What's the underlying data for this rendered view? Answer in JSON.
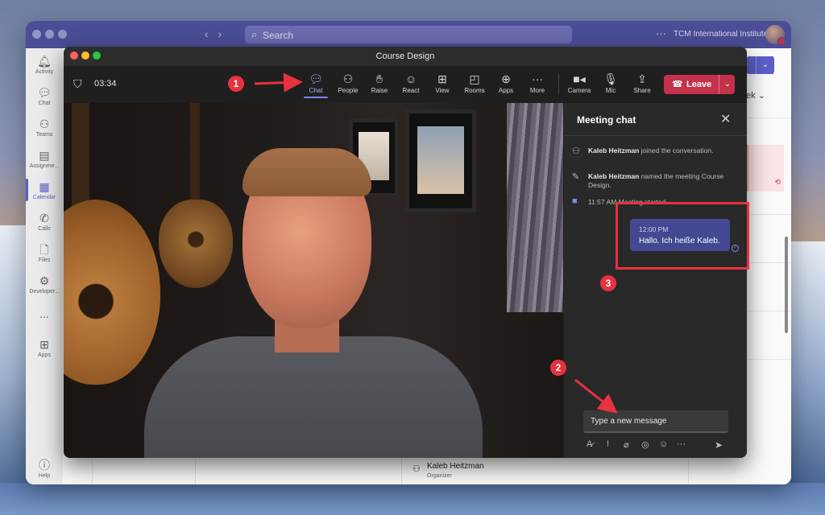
{
  "teams_window": {
    "search_placeholder": "Search",
    "more_icon": "ellipsis-icon",
    "org_name": "TCM International Institute",
    "rail": [
      {
        "label": "Activity",
        "icon": "bell-icon"
      },
      {
        "label": "Chat",
        "icon": "chat-icon"
      },
      {
        "label": "Teams",
        "icon": "teams-icon"
      },
      {
        "label": "Assignme...",
        "icon": "assignments-icon"
      },
      {
        "label": "Calendar",
        "icon": "calendar-icon",
        "active": true
      },
      {
        "label": "Calls",
        "icon": "phone-icon"
      },
      {
        "label": "Files",
        "icon": "file-icon"
      },
      {
        "label": "Developer...",
        "icon": "developer-icon"
      },
      {
        "label": "...",
        "icon": "more-icon"
      },
      {
        "label": "Apps",
        "icon": "apps-icon"
      },
      {
        "label": "Help",
        "icon": "help-icon"
      }
    ],
    "calendar": {
      "view_label": "ek",
      "organizer_name": "Kaleb Heitzman",
      "organizer_role": "Organizer"
    }
  },
  "meeting": {
    "title": "Course Design",
    "timer": "03:34",
    "toolbar": [
      {
        "label": "Chat",
        "icon": "chat-icon",
        "active": true
      },
      {
        "label": "People",
        "icon": "people-icon"
      },
      {
        "label": "Raise",
        "icon": "raise-hand-icon"
      },
      {
        "label": "React",
        "icon": "smiley-icon"
      },
      {
        "label": "View",
        "icon": "grid-icon"
      },
      {
        "label": "Rooms",
        "icon": "rooms-icon"
      },
      {
        "label": "Apps",
        "icon": "plus-icon"
      },
      {
        "label": "More",
        "icon": "ellipsis-icon"
      },
      {
        "label": "Camera",
        "icon": "camera-icon"
      },
      {
        "label": "Mic",
        "icon": "mic-icon"
      },
      {
        "label": "Share",
        "icon": "share-icon"
      }
    ],
    "leave_label": "Leave",
    "chat_panel": {
      "title": "Meeting chat",
      "system_messages": [
        {
          "name": "Kaleb Heitzman",
          "text": "joined the conversation."
        },
        {
          "name": "Kaleb Heitzman",
          "text": "named the meeting Course Design."
        },
        {
          "name": "",
          "text": "11:57 AM  Meeting started"
        }
      ],
      "message": {
        "time": "12:00 PM",
        "text": "Hallo. Ich heiße Kaleb."
      },
      "compose_placeholder": "Type a new message"
    }
  },
  "annotations": [
    {
      "number": "1"
    },
    {
      "number": "2"
    },
    {
      "number": "3"
    }
  ],
  "colors": {
    "teams_purple": "#4b4d96",
    "accent": "#5b5fc7",
    "leave_red": "#c4314b",
    "annotation_red": "#e8323f",
    "bubble": "#444791"
  }
}
